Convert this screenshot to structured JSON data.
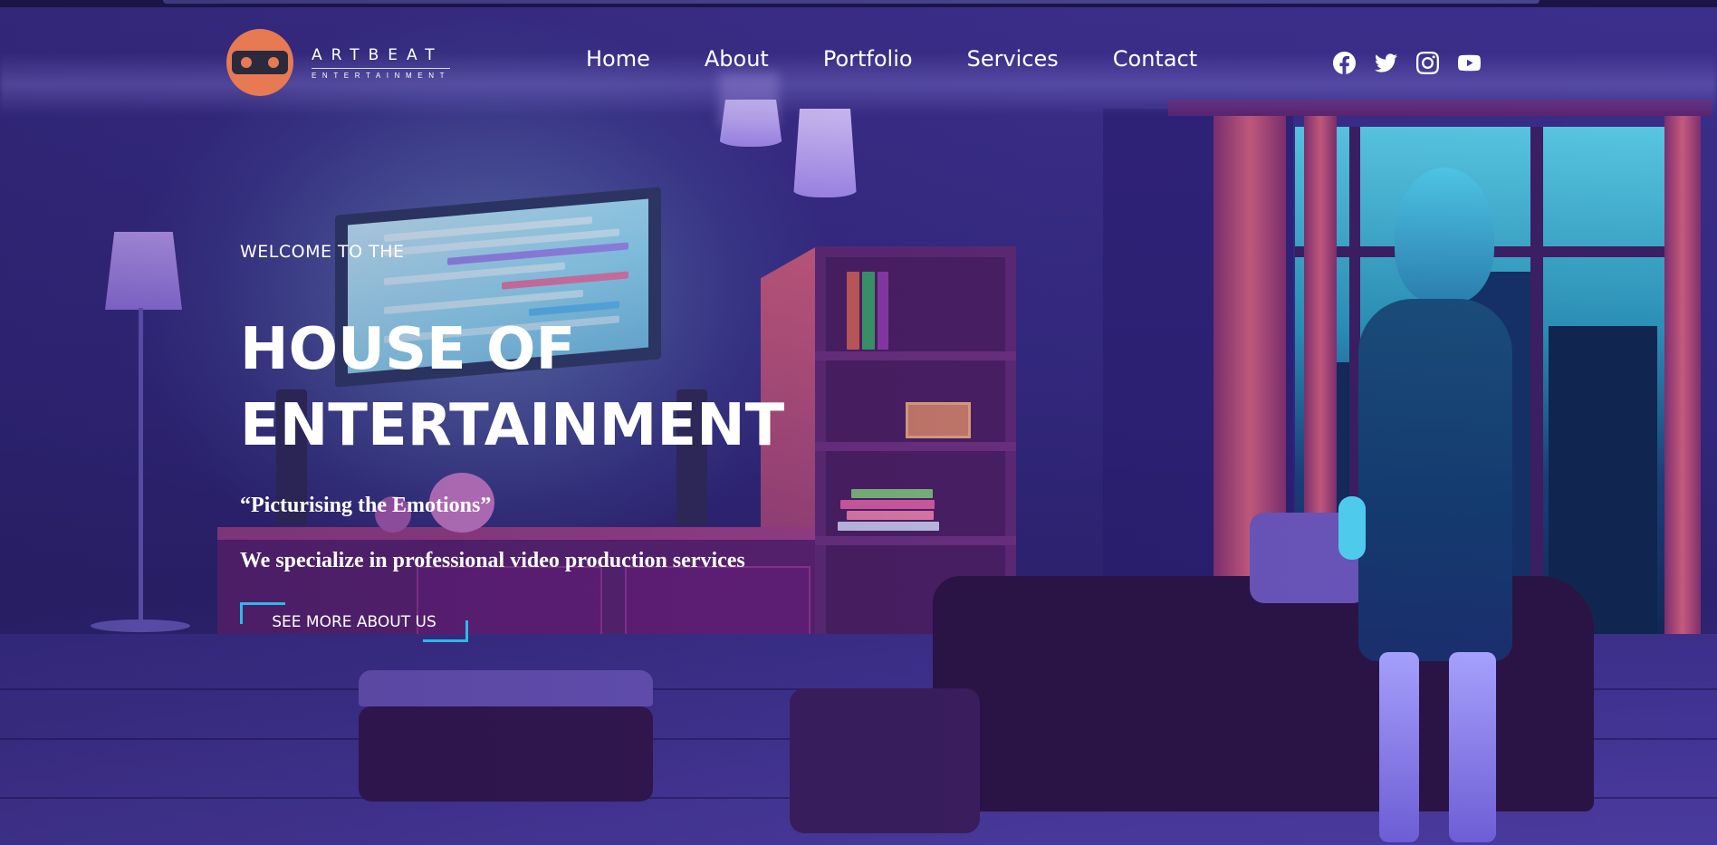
{
  "brand": {
    "name": "ARTBEAT",
    "subtitle": "ENTERTAINMENT",
    "logo_color": "#e77a52"
  },
  "nav": {
    "items": [
      {
        "label": "Home"
      },
      {
        "label": "About"
      },
      {
        "label": "Portfolio"
      },
      {
        "label": "Services"
      },
      {
        "label": "Contact"
      }
    ]
  },
  "social": {
    "icons": [
      "facebook-icon",
      "twitter-icon",
      "instagram-icon",
      "youtube-icon"
    ]
  },
  "hero": {
    "eyebrow": "WELCOME TO THE",
    "title_line1": "HOUSE OF",
    "title_line2": "ENTERTAINMENT",
    "tagline": "“Picturising the Emotions”",
    "subtitle": "We specialize in professional video production services",
    "cta_label": "SEE MORE ABOUT US"
  },
  "colors": {
    "accent": "#2fb8e8",
    "background": "#2a1f6b"
  }
}
